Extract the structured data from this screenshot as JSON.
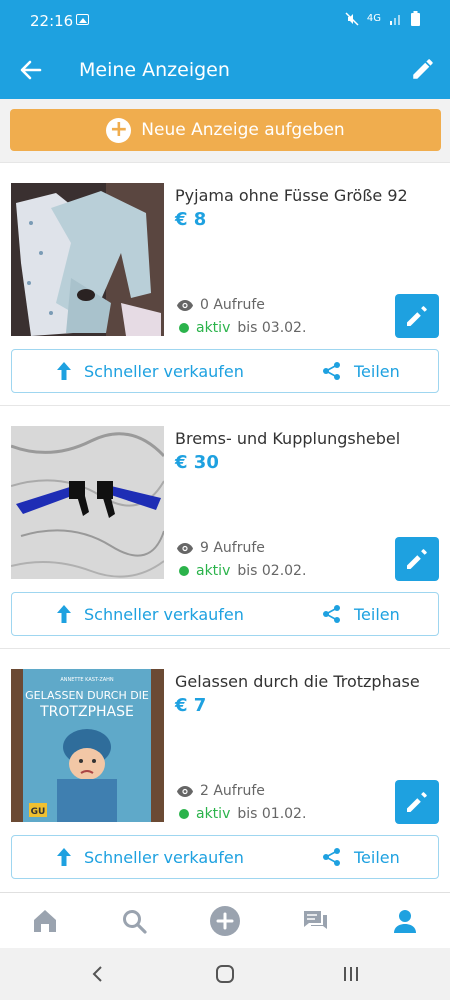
{
  "status_bar": {
    "time": "22:16",
    "network": "4G"
  },
  "app_bar": {
    "title": "Meine Anzeigen"
  },
  "new_listing_button": {
    "label": "Neue Anzeige aufgeben"
  },
  "listings": [
    {
      "title": "Pyjama ohne Füsse Größe 92",
      "price": "€ 8",
      "views": "0 Aufrufe",
      "status": "aktiv",
      "until": "bis 03.02."
    },
    {
      "title": "Brems- und Kupplungshebel",
      "price": "€ 30",
      "views": "9 Aufrufe",
      "status": "aktiv",
      "until": "bis 02.02."
    },
    {
      "title": "Gelassen durch die Trotzphase",
      "price": "€ 7",
      "views": "2 Aufrufe",
      "status": "aktiv",
      "until": "bis 01.02."
    }
  ],
  "actions": {
    "faster_sell": "Schneller verkaufen",
    "share": "Teilen"
  },
  "book_cover": {
    "author": "ANNETTE KAST-ZAHN",
    "title_line1": "GELASSEN DURCH DIE",
    "title_line2": "TROTZPHASE",
    "publisher": "GU"
  },
  "bottom_nav": [
    "home-icon",
    "search-icon",
    "add-icon",
    "messages-icon",
    "profile-icon"
  ],
  "colors": {
    "primary": "#1ea1e0",
    "accent": "#f0ad4e",
    "active": "#2bb34b"
  }
}
